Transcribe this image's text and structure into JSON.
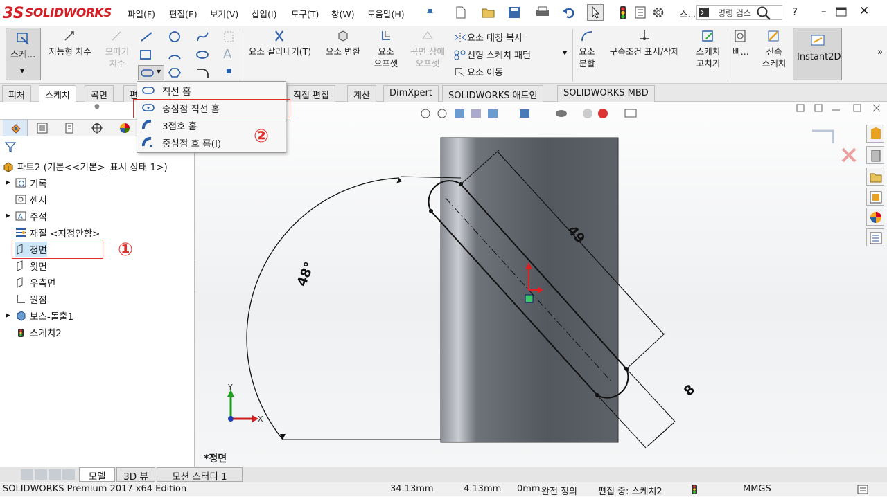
{
  "app": {
    "logo_text": "SOLIDWORKS",
    "logo_mark": "3S"
  },
  "menu": {
    "items": [
      "파일(F)",
      "편집(E)",
      "보기(V)",
      "삽입(I)",
      "도구(T)",
      "창(W)",
      "도움말(H)"
    ]
  },
  "titlebar": {
    "sketch_short": "스...",
    "search_placeholder": "명령 검스",
    "help": "?"
  },
  "ribbon": {
    "sketch": "스케...",
    "smart_dim": "지능형 치수",
    "chamfer_dim_1": "모따기",
    "chamfer_dim_2": "치수",
    "trim": "요소 잘라내기(T)",
    "convert": "요소 변환",
    "offset_1": "요소",
    "offset_2": "오프셋",
    "offset_surface_1": "곡면 상에",
    "offset_surface_2": "오프셋",
    "mirror": "요소 대칭 복사",
    "linear_pattern": "선형 스케치 패턴",
    "move": "요소 이동",
    "split_1": "요소",
    "split_2": "분할",
    "relations": "구속조건 표시/삭제",
    "repair_1": "스케치",
    "repair_2": "고치기",
    "quick_1": "빠...",
    "rapid_1": "신속",
    "rapid_2": "스케치",
    "instant2d": "Instant2D"
  },
  "tabs": [
    "피처",
    "스케치",
    "곡면",
    "편",
    "직접 편집",
    "계산",
    "DimXpert",
    "SOLIDWORKS 애드인",
    "SOLIDWORKS MBD"
  ],
  "dropdown": {
    "items": [
      "직선 홈",
      "중심점 직선 홈",
      "3점호 홈",
      "중심점 호 홈(I)"
    ]
  },
  "tree": {
    "root": "파트2  (기본<<기본>_표시 상태 1>)",
    "items": [
      "기록",
      "센서",
      "주석",
      "재질 <지정안함>",
      "정면",
      "윗면",
      "우측면",
      "원점",
      "보스-돌출1",
      "스케치2"
    ]
  },
  "annotations": {
    "one": "①",
    "two": "②"
  },
  "viewport": {
    "dim_angle": "48°",
    "dim_length": "49",
    "dim_width": "8",
    "view_label": "*정면",
    "axis_x": "X",
    "axis_y": "Y"
  },
  "bottom_tabs": [
    "모델",
    "3D 뷰",
    "모션 스터디 1"
  ],
  "status": {
    "edition": "SOLIDWORKS Premium 2017 x64 Edition",
    "x": "34.13mm",
    "y": "4.13mm",
    "z": "0mm",
    "defined": "완전 정의",
    "editing": "편집 중: 스케치2",
    "units": "MMGS"
  },
  "colors": {
    "accent_red": "#e0302c",
    "logo_red": "#d32027",
    "selection_blue": "#cde6f7"
  }
}
